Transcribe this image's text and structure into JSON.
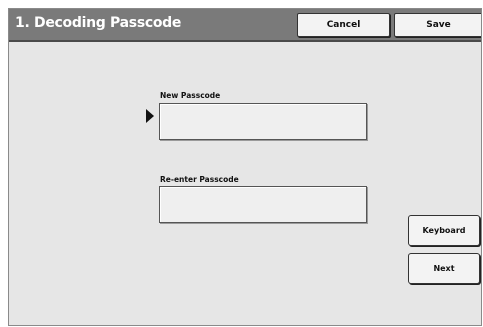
{
  "header": {
    "title": "1. Decoding Passcode",
    "cancel_label": "Cancel",
    "save_label": "Save"
  },
  "form": {
    "new_passcode_label": "New Passcode",
    "new_passcode_value": "",
    "reenter_passcode_label": "Re-enter Passcode",
    "reenter_passcode_value": ""
  },
  "side_buttons": {
    "keyboard_label": "Keyboard",
    "next_label": "Next"
  },
  "icons": {
    "focus_pointer": "right-arrow-icon"
  },
  "colors": {
    "header_bg": "#7a7a7a",
    "panel_bg": "#e6e6e6",
    "button_bg": "#f3f3f3"
  }
}
